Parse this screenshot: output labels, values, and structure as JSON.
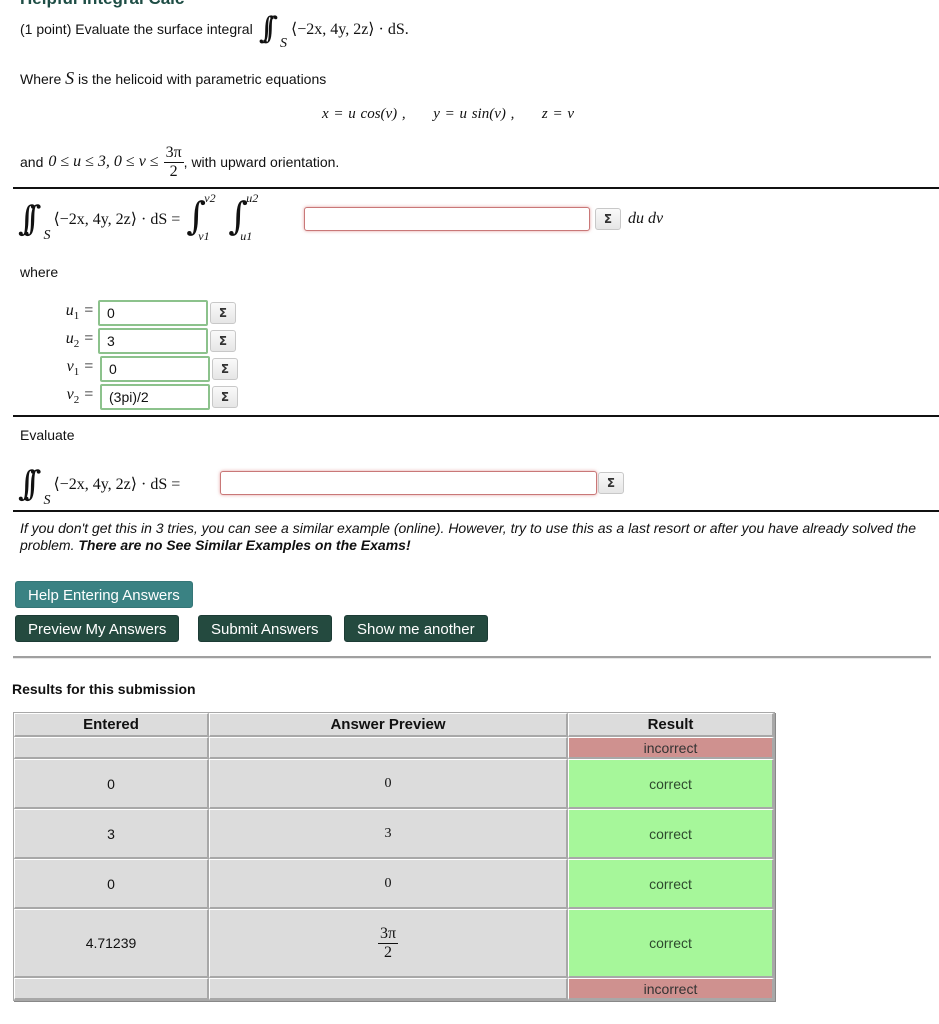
{
  "header": {
    "cutoff_title": "Helpful Integral Calc"
  },
  "problem": {
    "points_label": "(1 point) Evaluate the surface integral",
    "integrand": "⟨−2x, 4y, 2z⟩ · dS.",
    "surface_symbol": "S",
    "where_prefix": "Where",
    "where_suffix": "is the helicoid with parametric equations",
    "param_x": "x = u cos(v) ,",
    "param_y": "y = u sin(v) ,",
    "param_z": "z = v",
    "bounds_prefix": "and",
    "bounds_math": "0 ≤ u ≤ 3,  0 ≤ v ≤",
    "bounds_frac_num": "3π",
    "bounds_frac_den": "2",
    "bounds_suffix": ", with upward orientation."
  },
  "part1": {
    "lhs": "⟨−2x, 4y, 2z⟩ · dS =",
    "outer_upper": "v2",
    "outer_lower": "v1",
    "inner_upper": "u2",
    "inner_lower": "u1",
    "answer_value": "",
    "differentials": "du dv",
    "where_label": "where",
    "limits": [
      {
        "label": "u",
        "sub": "1",
        "value": "0"
      },
      {
        "label": "u",
        "sub": "2",
        "value": "3"
      },
      {
        "label": "v",
        "sub": "1",
        "value": "0"
      },
      {
        "label": "v",
        "sub": "2",
        "value": "(3pi)/2"
      }
    ],
    "sigma_icon": "Σ"
  },
  "part2": {
    "evaluate_label": "Evaluate",
    "lhs": "⟨−2x, 4y, 2z⟩ · dS =",
    "answer_value": ""
  },
  "note": {
    "italic_text": "If you don't get this in 3 tries, you can see a similar example (online). However, try to use this as a last resort or after you have already solved the problem.",
    "bold_text": "There are no See Similar Examples on the Exams!"
  },
  "buttons": {
    "help": "Help Entering Answers",
    "preview": "Preview My Answers",
    "submit": "Submit Answers",
    "show_another": "Show me another"
  },
  "results": {
    "title": "Results for this submission",
    "columns": [
      "Entered",
      "Answer Preview",
      "Result"
    ],
    "rows": [
      {
        "entered": "",
        "preview": "",
        "result": "incorrect"
      },
      {
        "entered": "0",
        "preview": "0",
        "result": "correct"
      },
      {
        "entered": "3",
        "preview": "3",
        "result": "correct"
      },
      {
        "entered": "0",
        "preview": "0",
        "result": "correct"
      },
      {
        "entered": "4.71239",
        "preview_num": "3π",
        "preview_den": "2",
        "result": "correct"
      },
      {
        "entered": "",
        "preview": "",
        "result": "incorrect"
      }
    ]
  },
  "colors": {
    "correct": "#a6f79a",
    "incorrect": "#cf918f",
    "button_dark": "#244a3f",
    "button_teal": "#3a8283"
  }
}
